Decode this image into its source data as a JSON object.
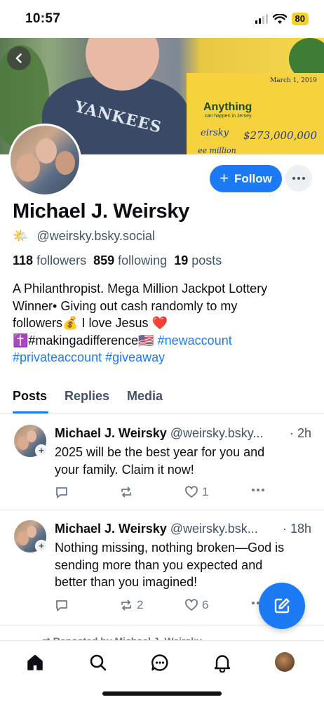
{
  "status_bar": {
    "time": "10:57",
    "battery": "80"
  },
  "banner": {
    "check_date": "March 1, 2019",
    "check_anything": "Anything",
    "check_sub": "can happen in Jersey.",
    "check_name": "eirsky",
    "check_amount": "$273,000,000",
    "check_million": "ee million",
    "shirt_text": "YANKEES"
  },
  "profile": {
    "display_name": "Michael J. Weirsky",
    "handle_emoji": "🌤️",
    "handle": "@weirsky.bsky.social",
    "followers_count": "118",
    "followers_label": "followers",
    "following_count": "859",
    "following_label": "following",
    "posts_count": "19",
    "posts_label": "posts",
    "bio_line1": "A Philanthropist. Mega Million Jackpot Lottery",
    "bio_line2": "Winner• Giving out cash randomly to my",
    "bio_line3": "followers💰 I love Jesus ❤️",
    "bio_line4_text": "✝️#makingadifference🇺🇸",
    "bio_tag1": "#newaccount",
    "bio_tag2": "#privateaccount",
    "bio_tag3": "#giveaway"
  },
  "actions": {
    "follow_label": "Follow",
    "follow_plus": "+"
  },
  "tabs": [
    {
      "label": "Posts"
    },
    {
      "label": "Replies"
    },
    {
      "label": "Media"
    }
  ],
  "posts": [
    {
      "name": "Michael J. Weirsky",
      "handle": "@weirsky.bsky...",
      "time": "· 2h",
      "text_line1": "2025 will be the best year for you and",
      "text_line2": "your family.  Claim it now!",
      "reposts": "",
      "likes": "1"
    },
    {
      "name": "Michael J. Weirsky",
      "handle": "@weirsky.bsk...",
      "time": "· 18h",
      "text_line1": "Nothing missing, nothing broken—God is",
      "text_line2": "sending more than you expected and",
      "text_line3": "better than you imagined!",
      "reposts": "2",
      "likes": "6"
    }
  ],
  "repost_peek": "⇄ Reposted by Michael J. Weirsky",
  "icons": {
    "back": "chevron-left-icon",
    "more": "ellipsis-icon",
    "reply": "speech-bubble-icon",
    "repost": "repost-arrows-icon",
    "like": "heart-icon",
    "compose": "pencil-square-icon",
    "nav": [
      "home-icon",
      "search-icon",
      "chat-icon",
      "bell-icon",
      "profile-avatar"
    ]
  },
  "colors": {
    "accent": "#1c7af5",
    "muted": "#425366",
    "battery": "#f4d22b"
  }
}
